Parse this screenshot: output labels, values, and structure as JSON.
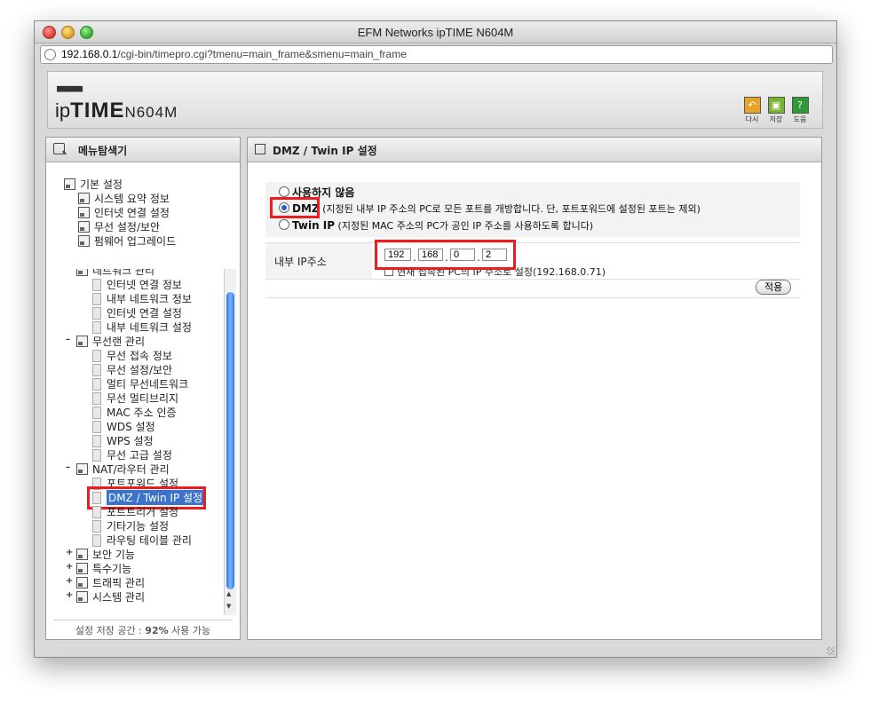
{
  "window": {
    "title": "EFM Networks ipTIME N604M"
  },
  "address": {
    "host": "192.168.0.1",
    "path": "/cgi-bin/timepro.cgi?tmenu=main_frame&smenu=main_frame"
  },
  "brand": {
    "logo_dots": "■■■■■",
    "logo_prefix": "ip",
    "logo_main": "TIME",
    "model": "N604M"
  },
  "header_buttons": [
    {
      "label": "다시",
      "icon": "undo-icon",
      "color": "#e9a32a"
    },
    {
      "label": "저장",
      "icon": "save-icon",
      "color": "#79b331"
    },
    {
      "label": "도움",
      "icon": "help-icon",
      "color": "#2f9a3a"
    }
  ],
  "left_panel": {
    "title": "메뉴탐색기",
    "basic_group": "기본 설정",
    "basic_items": [
      "시스템 요약 정보",
      "인터넷 연결 설정",
      "무선 설정/보안",
      "펌웨어 업그레이드"
    ],
    "tree_rows": [
      {
        "label": "네트워크 관리",
        "type": "folder",
        "toggle": "–"
      },
      {
        "label": "인터넷 연결 정보",
        "type": "page"
      },
      {
        "label": "내부 네트워크 정보",
        "type": "page"
      },
      {
        "label": "인터넷 연결 설정",
        "type": "page"
      },
      {
        "label": "내부 네트워크 설정",
        "type": "page"
      },
      {
        "label": "무선랜 관리",
        "type": "folder",
        "toggle": "–"
      },
      {
        "label": "무선 접속 정보",
        "type": "page"
      },
      {
        "label": "무선 설정/보안",
        "type": "page"
      },
      {
        "label": "멀티 무선네트워크",
        "type": "page"
      },
      {
        "label": "무선 멀티브리지",
        "type": "page"
      },
      {
        "label": "MAC 주소 인증",
        "type": "page"
      },
      {
        "label": "WDS 설정",
        "type": "page"
      },
      {
        "label": "WPS 설정",
        "type": "page"
      },
      {
        "label": "무선 고급 설정",
        "type": "page"
      },
      {
        "label": "NAT/라우터 관리",
        "type": "folder",
        "toggle": "–"
      },
      {
        "label": "포트포워드 설정",
        "type": "page"
      },
      {
        "label": "DMZ / Twin IP 설정",
        "type": "page",
        "selected": true
      },
      {
        "label": "포트트리거 설정",
        "type": "page"
      },
      {
        "label": "기타기능 설정",
        "type": "page"
      },
      {
        "label": "라우팅 테이블 관리",
        "type": "page"
      },
      {
        "label": "보안 기능",
        "type": "folder",
        "toggle": "+"
      },
      {
        "label": "특수기능",
        "type": "folder",
        "toggle": "+"
      },
      {
        "label": "트래픽 관리",
        "type": "folder",
        "toggle": "+"
      },
      {
        "label": "시스템 관리",
        "type": "folder",
        "toggle": "+"
      }
    ],
    "footer_prefix": "설정 저장 공간 : ",
    "footer_value": "92%",
    "footer_suffix": " 사용 가능"
  },
  "main": {
    "title": "DMZ / Twin IP 설정",
    "options": [
      {
        "name": "사용하지 않음",
        "desc": "",
        "selected": false
      },
      {
        "name": "DMZ",
        "desc": "(지정된 내부 IP 주소의 PC로 모든 포트를 개방합니다. 단, 포트포워드에 설정된 포트는 제외)",
        "selected": true
      },
      {
        "name": "Twin IP",
        "desc": "(지정된 MAC 주소의 PC가 공인 IP 주소를 사용하도록 합니다)",
        "selected": false
      }
    ],
    "ip_label": "내부 IP주소",
    "ip": [
      "192",
      "168",
      "0",
      "2"
    ],
    "checkbox_label": "현재 접속된 PC의 IP 주소로 설정(192.168.0.71)",
    "apply_label": "적용"
  }
}
